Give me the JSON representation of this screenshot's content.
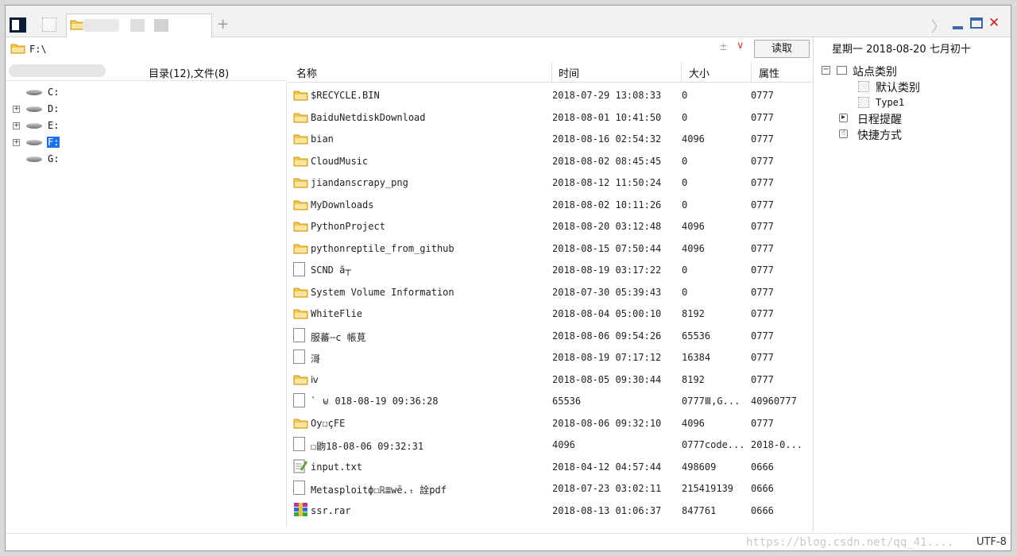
{
  "titlebar": {
    "add_tab": "+",
    "chevron": "〉",
    "close": "✕"
  },
  "address": {
    "path": "F:\\",
    "read_button": "读取"
  },
  "date": "星期一 2018-08-20 七月初十",
  "left": {
    "counts": "目录(12),文件(8)",
    "drives": [
      {
        "label": "C:",
        "expandable": false,
        "selected": false
      },
      {
        "label": "D:",
        "expandable": true,
        "selected": false
      },
      {
        "label": "E:",
        "expandable": true,
        "selected": false
      },
      {
        "label": "F:",
        "expandable": true,
        "selected": true
      },
      {
        "label": "G:",
        "expandable": false,
        "selected": false
      }
    ]
  },
  "columns": {
    "name": "名称",
    "time": "时间",
    "size": "大小",
    "attr": "属性"
  },
  "files": [
    {
      "icon": "folder-icon",
      "name": "$RECYCLE.BIN",
      "time": "2018-07-29 13:08:33",
      "size": "0",
      "attr": "0777"
    },
    {
      "icon": "folder-icon",
      "name": "BaiduNetdiskDownload",
      "time": "2018-08-01 10:41:50",
      "size": "0",
      "attr": "0777"
    },
    {
      "icon": "folder-icon",
      "name": "bian",
      "time": "2018-08-16 02:54:32",
      "size": "4096",
      "attr": "0777"
    },
    {
      "icon": "folder-icon",
      "name": "CloudMusic",
      "time": "2018-08-02 08:45:45",
      "size": "0",
      "attr": "0777"
    },
    {
      "icon": "folder-icon",
      "name": "jiandanscrapy_png",
      "time": "2018-08-12 11:50:24",
      "size": "0",
      "attr": "0777"
    },
    {
      "icon": "folder-icon",
      "name": "MyDownloads",
      "time": "2018-08-02 10:11:26",
      "size": "0",
      "attr": "0777"
    },
    {
      "icon": "folder-icon",
      "name": "PythonProject",
      "time": "2018-08-20 03:12:48",
      "size": "4096",
      "attr": "0777"
    },
    {
      "icon": "folder-icon",
      "name": "pythonreptile_from_github",
      "time": "2018-08-15 07:50:44",
      "size": "4096",
      "attr": "0777"
    },
    {
      "icon": "file-icon",
      "name": "SCND  ã┬",
      "time": "2018-08-19 03:17:22",
      "size": "0",
      "attr": "0777"
    },
    {
      "icon": "folder-icon",
      "name": "System Volume Information",
      "time": "2018-07-30 05:39:43",
      "size": "0",
      "attr": "0777"
    },
    {
      "icon": "folder-icon",
      "name": "WhiteFlie",
      "time": "2018-08-04 05:00:10",
      "size": "8192",
      "attr": "0777"
    },
    {
      "icon": "file-icon",
      "name": "服蕃╌c  帳莧",
      "time": "2018-08-06 09:54:26",
      "size": "65536",
      "attr": "0777"
    },
    {
      "icon": "file-icon",
      "name": "滒",
      "time": "2018-08-19 07:17:12",
      "size": "16384",
      "attr": "0777"
    },
    {
      "icon": "folder-icon",
      "name": "ⅳ",
      "time": "2018-08-05 09:30:44",
      "size": "8192",
      "attr": "0777"
    },
    {
      "icon": "file-icon",
      "name": "`  ⊌  018-08-19 09:36:28",
      "time": "65536",
      "size": "0777Ⅲ,G...",
      "attr": "40960777"
    },
    {
      "icon": "folder-icon",
      "name": "Oy☐çFE",
      "time": "2018-08-06 09:32:10",
      "size": "4096",
      "attr": "0777"
    },
    {
      "icon": "file-icon",
      "name": "☐鼩18-08-06 09:32:31",
      "time": "4096",
      "size": "0777code...",
      "attr": "2018-0..."
    },
    {
      "icon": "txt-file-icon",
      "name": "input.txt",
      "time": "2018-04-12 04:57:44",
      "size": "498609",
      "attr": "0666"
    },
    {
      "icon": "file-icon",
      "name": "Metasploitф☐ℝ≣wē.ₜ 詮pdf",
      "time": "2018-07-23 03:02:11",
      "size": "215419139",
      "attr": "0666"
    },
    {
      "icon": "rar-file-icon",
      "name": "ssr.rar",
      "time": "2018-08-13 01:06:37",
      "size": "847761",
      "attr": "0666"
    }
  ],
  "right": {
    "site_category": "站点类别",
    "default_category": "默认类别",
    "type1": "Type1",
    "schedule": "日程提醒",
    "shortcuts": "快捷方式"
  },
  "status": {
    "watermark": "https://blog.csdn.net/qq_41....",
    "encoding": "UTF-8"
  },
  "colors": {
    "selection": "#1a73e8",
    "folder": "#f2c94c",
    "close": "#d01b1b",
    "window_controls": "#3f66a5"
  }
}
